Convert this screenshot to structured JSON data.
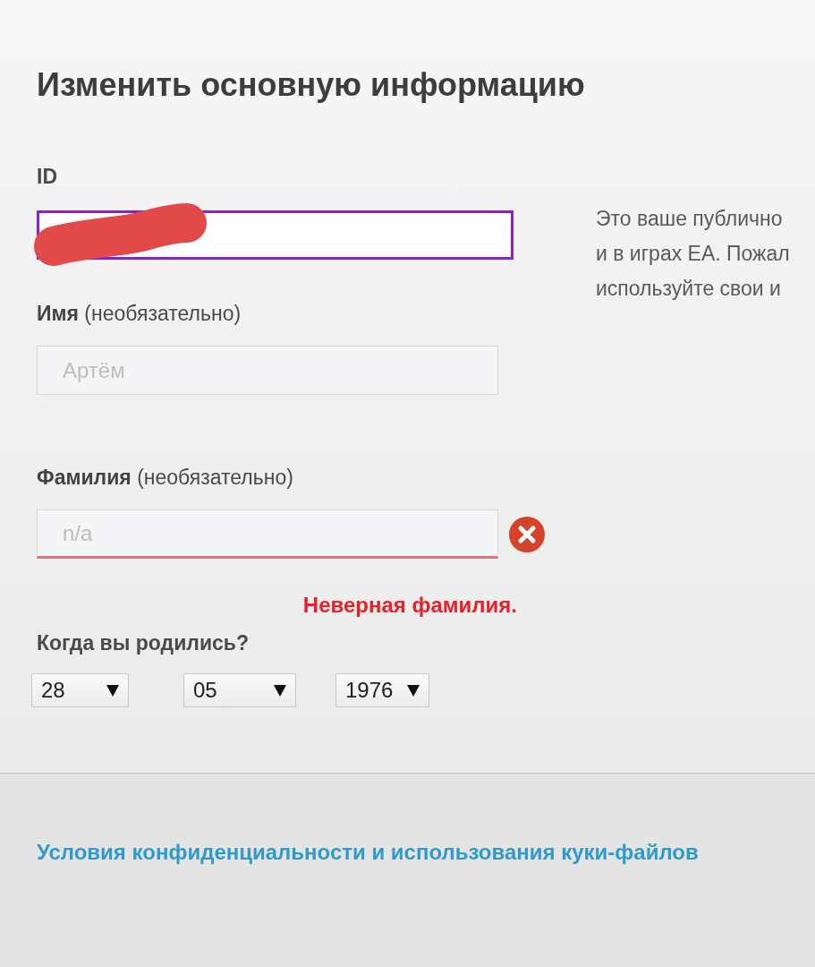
{
  "heading": "Изменить основную информацию",
  "id_field": {
    "label": "ID",
    "focused": true,
    "redacted": true,
    "description_lines": [
      "Это ваше публично",
      "и в играх EA. Пожал",
      "используйте свои и"
    ]
  },
  "first_name": {
    "label": "**Имя** (необязательно)",
    "placeholder": "Артём",
    "invalid": false
  },
  "last_name": {
    "label": "**Фамилия** (необязательно)",
    "placeholder": "n/a",
    "invalid": true,
    "error": "Неверная фамилия."
  },
  "birth_date": {
    "label": "Когда вы родились?",
    "selects": [
      {
        "kind": "day",
        "value": "28"
      },
      {
        "kind": "month",
        "value": "05"
      },
      {
        "kind": "year",
        "value": "1976"
      }
    ]
  },
  "footer": {
    "link": "Условия конфиденциальности и использования куки-файлов"
  }
}
